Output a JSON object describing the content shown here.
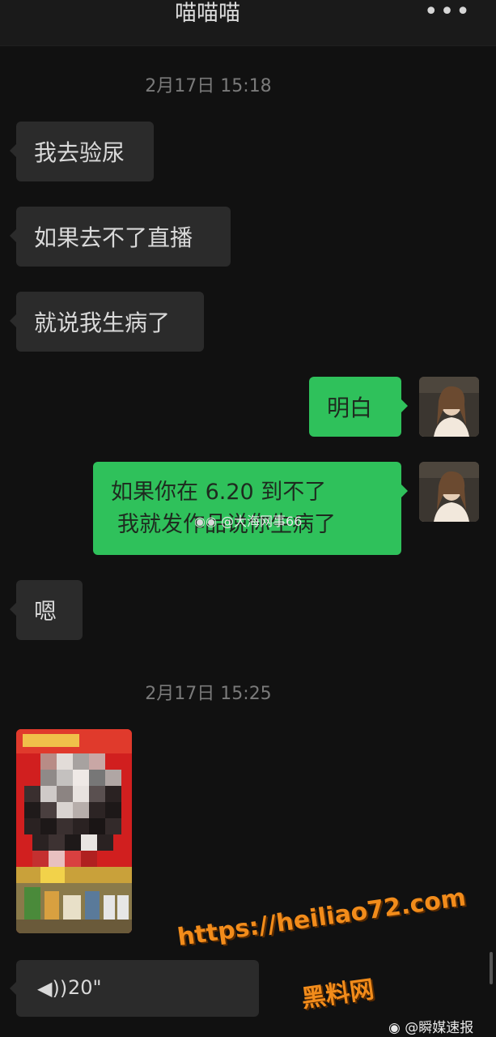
{
  "header": {
    "title": "喵喵喵",
    "more_icon": "more-dots-icon"
  },
  "messages": {
    "timestamp1": "2月17日 15:18",
    "msg1": "我去验尿",
    "msg2": "如果去不了直播",
    "msg3": "就说我生病了",
    "msg4": "明白",
    "msg5_line1": "如果你在 6.20 到不了",
    "msg5_line2": "我就发作品说你生病了",
    "msg6": "嗯",
    "timestamp2": "2月17日 15:25",
    "voice_duration": "20\""
  },
  "overlays": {
    "weibo_mid": "@大海网事66",
    "url": "https://heiliao72.com",
    "site_name": "黑料网",
    "weibo_bottom": "@瞬媒速报"
  }
}
